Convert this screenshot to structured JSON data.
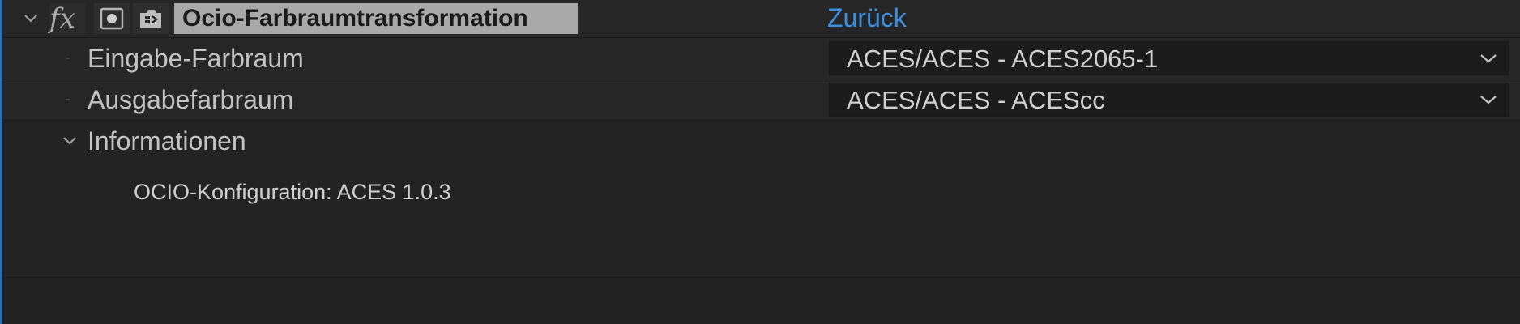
{
  "effect": {
    "name": "Ocio-Farbraumtransformation",
    "reset_label": "Zurück",
    "fx_label": "fx"
  },
  "params": [
    {
      "label": "Eingabe-Farbraum",
      "value": "ACES/ACES - ACES2065-1"
    },
    {
      "label": "Ausgabefarbraum",
      "value": "ACES/ACES - ACEScc"
    }
  ],
  "info": {
    "group_label": "Informationen",
    "config_text": "OCIO-Konfiguration: ACES 1.0.3"
  },
  "colors": {
    "accent": "#3a8fe0",
    "panel_bg": "#232323",
    "effect_name_bg": "#a9a9a9",
    "left_border": "#2f6fb5"
  },
  "icons": {
    "effect_twirl": "chevron-down-icon",
    "fx": "fx-icon",
    "effect_toggle": "effect-enable-icon",
    "preset": "preset-icon",
    "info_twirl": "chevron-down-icon",
    "dropdown_chevron": "chevron-down-icon"
  }
}
